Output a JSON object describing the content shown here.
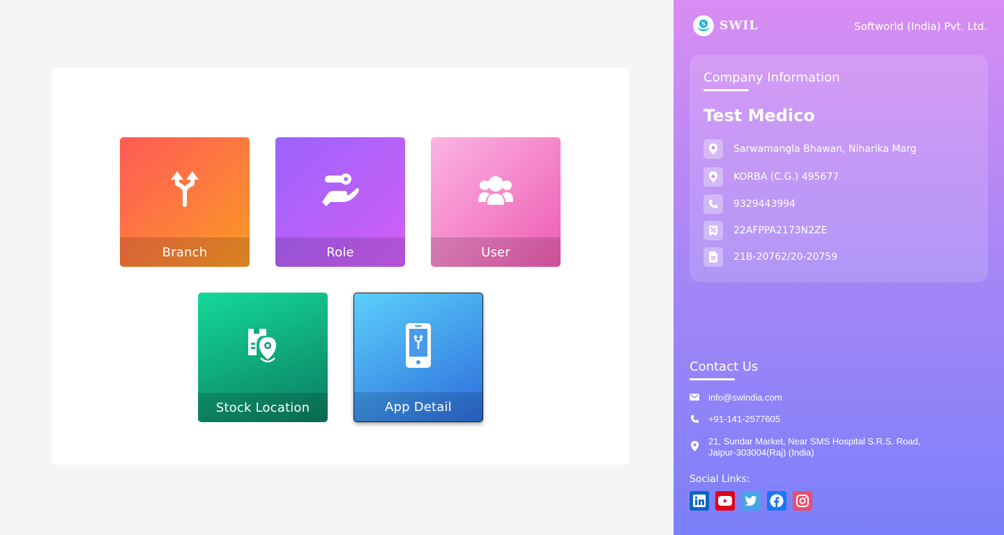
{
  "tiles": {
    "branch": {
      "label": "Branch",
      "icon": "branch-icon"
    },
    "role": {
      "label": "Role",
      "icon": "role-key-hand-icon"
    },
    "user": {
      "label": "User",
      "icon": "users-group-icon"
    },
    "stock_location": {
      "label": "Stock Location",
      "icon": "stock-location-icon"
    },
    "app_detail": {
      "label": "App Detail",
      "icon": "mobile-app-icon"
    }
  },
  "sidebar": {
    "brand": "SWIL",
    "company_legal_name": "Softworld (India) Pvt. Ltd.",
    "company_info": {
      "heading": "Company Information",
      "name": "Test Medico",
      "address_line": "Sarwamangla Bhawan, Niharika Marg",
      "city": "KORBA (C.G.) 495677",
      "phone": "9329443994",
      "gstin": "22AFPPA2173N2ZE",
      "license": "21B-20762/20-20759"
    },
    "contact": {
      "heading": "Contact Us",
      "email": "info@swindia.com",
      "phone": "+91-141-2577605",
      "address_line1": "21, Sundar Market, Near SMS Hospital S.R.S. Road,",
      "address_line2": "Jaipur-303004(Raj) (India)"
    },
    "social": {
      "label": "Social Links:",
      "links": [
        {
          "name": "linkedin",
          "color": "#0a66c2"
        },
        {
          "name": "youtube",
          "color": "#e0001b"
        },
        {
          "name": "twitter",
          "color": "#4aa3e8"
        },
        {
          "name": "facebook",
          "color": "#1877f2"
        },
        {
          "name": "instagram",
          "color": "#e84e6e"
        }
      ]
    }
  }
}
